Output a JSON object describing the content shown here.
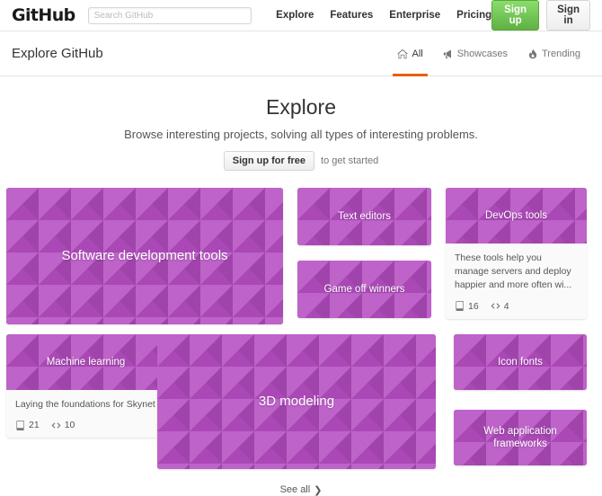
{
  "topbar": {
    "logo": "GitHub",
    "search_placeholder": "Search GitHub",
    "search_value": "",
    "nav": [
      {
        "label": "Explore"
      },
      {
        "label": "Features"
      },
      {
        "label": "Enterprise"
      },
      {
        "label": "Pricing"
      }
    ],
    "signup_label": "Sign up",
    "signin_label": "Sign in",
    "signup_color": "#60b044"
  },
  "subheader": {
    "title": "Explore GitHub",
    "tabs": [
      {
        "label": "All",
        "icon": "home-icon",
        "active": true
      },
      {
        "label": "Showcases",
        "icon": "megaphone-icon",
        "active": false
      },
      {
        "label": "Trending",
        "icon": "flame-icon",
        "active": false
      }
    ],
    "active_underline_color": "#e36209"
  },
  "hero": {
    "title": "Explore",
    "subtitle": "Browse interesting projects, solving all types of interesting problems.",
    "cta_label": "Sign up for free",
    "cta_note": "to get started"
  },
  "cards": [
    {
      "id": "software-development-tools",
      "title": "Software development tools",
      "color": "#b44cc0",
      "pattern": "triangles",
      "title_size": "15px",
      "has_body": false
    },
    {
      "id": "text-editors",
      "title": "Text editors",
      "color": "#3db63d",
      "pattern": "chevrons",
      "title_size": "11.5px",
      "has_body": false
    },
    {
      "id": "game-off-winners",
      "title": "Game off winners",
      "color": "#dd1f77",
      "pattern": "plaid",
      "title_size": "11.5px",
      "has_body": false
    },
    {
      "id": "devops-tools",
      "title": "DevOps tools",
      "color": "#c09550",
      "pattern": "circles",
      "title_size": "11.5px",
      "has_body": true,
      "description": "These tools help you manage servers and deploy happier and more often wi...",
      "repos": "16",
      "code": "4"
    },
    {
      "id": "machine-learning",
      "title": "Machine learning",
      "color": "#2ec07c",
      "pattern": "hexagons",
      "title_size": "11.5px",
      "has_body": true,
      "description": "Laying the foundations for Skynet",
      "repos": "21",
      "code": "10"
    },
    {
      "id": "3d-modeling",
      "title": "3D modeling",
      "color": "#3350d8",
      "pattern": "blobs",
      "title_size": "15px",
      "has_body": false
    },
    {
      "id": "icon-fonts",
      "title": "Icon fonts",
      "color": "#4a82b0",
      "pattern": "rings",
      "title_size": "11.5px",
      "has_body": false
    },
    {
      "id": "web-application-frameworks",
      "title": "Web application frameworks",
      "color": "#4727dd",
      "pattern": "squares",
      "title_size": "11.5px",
      "has_body": false
    }
  ],
  "footer": {
    "see_all_label": "See all",
    "chevron": "❯"
  }
}
